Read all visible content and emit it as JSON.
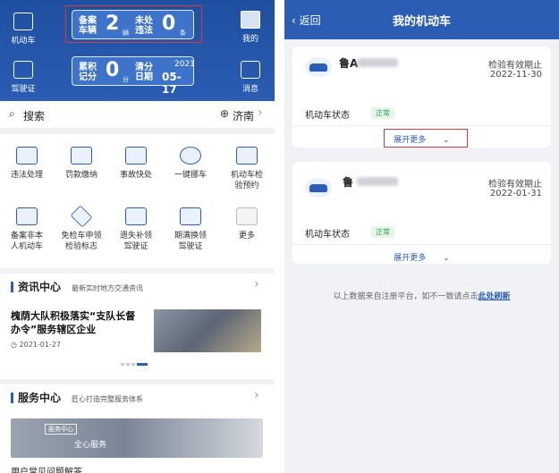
{
  "left": {
    "header": {
      "vehicle_btn": "机动车",
      "registered_label": [
        "备案",
        "车辆"
      ],
      "registered_count": "2",
      "registered_unit": "辆",
      "unhandled_label": [
        "未处",
        "违法"
      ],
      "unhandled_count": "0",
      "unhandled_unit": "条",
      "mine_btn": "我的",
      "license_btn": "驾驶证",
      "points_label": [
        "累积",
        "记分"
      ],
      "points_value": "0",
      "points_unit": "分",
      "clear_label": [
        "清分",
        "日期"
      ],
      "clear_year": "2021",
      "clear_date": "05-17",
      "msg_btn": "消息"
    },
    "search": {
      "label": "搜索",
      "city": "济南"
    },
    "services": [
      {
        "l1": "违法处理",
        "l2": ""
      },
      {
        "l1": "罚款缴纳",
        "l2": ""
      },
      {
        "l1": "事故快处",
        "l2": ""
      },
      {
        "l1": "一键挪车",
        "l2": ""
      },
      {
        "l1": "机动车检",
        "l2": "验预约"
      },
      {
        "l1": "备案非本",
        "l2": "人机动车"
      },
      {
        "l1": "免检车申领",
        "l2": "检验标志"
      },
      {
        "l1": "遗失补领",
        "l2": "驾驶证"
      },
      {
        "l1": "期满换领",
        "l2": "驾驶证"
      },
      {
        "l1": "更多",
        "l2": ""
      }
    ],
    "news": {
      "title": "资讯中心",
      "sub": "最新实时地方交通资讯",
      "headline1": "槐荫大队积极落实“支队长督",
      "headline2": "办令”服务辖区企业",
      "date": "2021-01-27"
    },
    "service_center": {
      "title": "服务中心",
      "sub": "匠心打造完整服务体系",
      "banner_tag": "服务中心",
      "banner_text": "全心服务",
      "faq": "用户常见问题解答"
    }
  },
  "right": {
    "back": "返回",
    "title": "我的机动车",
    "vehicles": [
      {
        "plate": "鲁A",
        "validity_label": "检验有效期止",
        "validity_date": "2022-11-30",
        "status_label": "机动车状态",
        "status": "正常",
        "more": "展开更多"
      },
      {
        "plate": "鲁",
        "validity_label": "检验有效期止",
        "validity_date": "2022-01-31",
        "status_label": "机动车状态",
        "status": "正常",
        "more": "展开更多"
      }
    ],
    "footer": "以上数据来自注册平台，如不一致请点击",
    "footer_link": "此处刷新"
  },
  "colors": {
    "primary": "#2a5db3",
    "highlight_box": "#d93a3a",
    "status_green": "#2e9b52"
  }
}
